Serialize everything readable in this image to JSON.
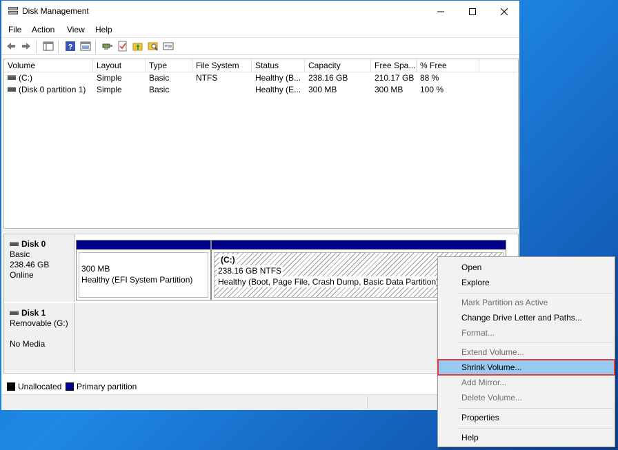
{
  "window": {
    "title": "Disk Management"
  },
  "menu": [
    "File",
    "Action",
    "View",
    "Help"
  ],
  "toolbar_icons": [
    "back-arrow-icon",
    "forward-arrow-icon",
    "show-hide-console-tree-icon",
    "help-icon",
    "properties-pane-icon",
    "connect-icon",
    "check-icon",
    "folder-up-icon",
    "search-folder-icon",
    "settings-icon"
  ],
  "volumes": {
    "columns": [
      "Volume",
      "Layout",
      "Type",
      "File System",
      "Status",
      "Capacity",
      "Free Spa...",
      "% Free"
    ],
    "rows": [
      [
        "(C:)",
        "Simple",
        "Basic",
        "NTFS",
        "Healthy (B...",
        "238.16 GB",
        "210.17 GB",
        "88 %"
      ],
      [
        "(Disk 0 partition 1)",
        "Simple",
        "Basic",
        "",
        "Healthy (E...",
        "300 MB",
        "300 MB",
        "100 %"
      ]
    ]
  },
  "disks": [
    {
      "name": "Disk 0",
      "type": "Basic",
      "size": "238.46 GB",
      "status": "Online",
      "partitions": [
        {
          "title": "",
          "size": "300 MB",
          "status": "Healthy (EFI System Partition)"
        },
        {
          "title": "(C:)",
          "size": "238.16 GB NTFS",
          "status": "Healthy (Boot, Page File, Crash Dump, Basic Data Partition)"
        }
      ]
    },
    {
      "name": "Disk 1",
      "type": "Removable (G:)",
      "status": "No Media"
    }
  ],
  "legend": [
    {
      "label": "Unallocated",
      "color": "#000000"
    },
    {
      "label": "Primary partition",
      "color": "#00008b"
    }
  ],
  "context_menu": {
    "items": [
      {
        "label": "Open",
        "enabled": true
      },
      {
        "label": "Explore",
        "enabled": true
      },
      {
        "label": "Mark Partition as Active",
        "enabled": false
      },
      {
        "label": "Change Drive Letter and Paths...",
        "enabled": true
      },
      {
        "label": "Format...",
        "enabled": false
      },
      {
        "label": "Extend Volume...",
        "enabled": false
      },
      {
        "label": "Shrink Volume...",
        "enabled": true,
        "highlighted": true
      },
      {
        "label": "Add Mirror...",
        "enabled": false
      },
      {
        "label": "Delete Volume...",
        "enabled": false
      },
      {
        "label": "Properties",
        "enabled": true
      },
      {
        "label": "Help",
        "enabled": true
      }
    ]
  },
  "colors": {
    "primary_partition": "#00008b",
    "highlight": "#99c9ef",
    "highlight_border": "#e53935",
    "desktop": "#1e88e5"
  }
}
